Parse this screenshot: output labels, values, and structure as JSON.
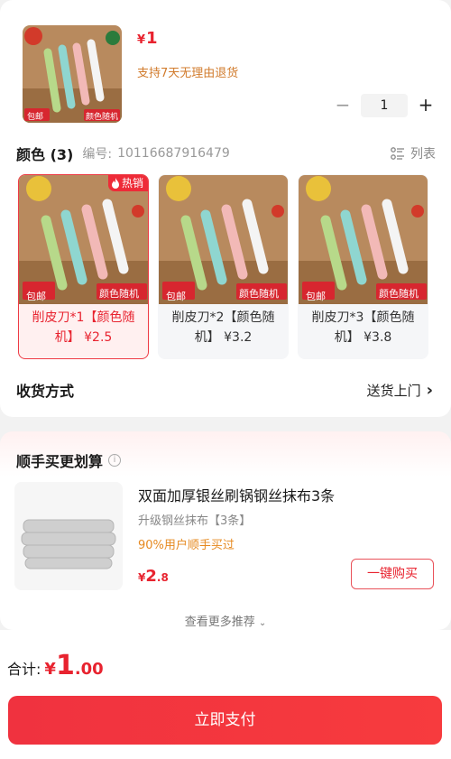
{
  "product": {
    "price_currency": "¥",
    "price": "1",
    "return_note": "支持7天无理由退货",
    "quantity": "1",
    "minus": "−",
    "plus": "+",
    "thumb_badge_left": "包邮",
    "thumb_badge_right": "颜色随机"
  },
  "color_section": {
    "title": "颜色 (3)",
    "sku_label": "编号:",
    "sku_number": "10116687916479",
    "list_toggle": "列表"
  },
  "variants": [
    {
      "label": "削皮刀*1【颜色随机】 ¥2.5",
      "selected": true,
      "badge": "热销",
      "tag_left": "包邮",
      "tag_right": "颜色随机"
    },
    {
      "label": "削皮刀*2【颜色随机】 ¥3.2",
      "selected": false,
      "tag_left": "包邮",
      "tag_right": "颜色随机"
    },
    {
      "label": "削皮刀*3【颜色随机】 ¥3.8",
      "selected": false,
      "tag_left": "包邮",
      "tag_right": "颜色随机"
    }
  ],
  "shipping": {
    "label": "收货方式",
    "value": "送货上门"
  },
  "bundle": {
    "title": "顺手买更划算",
    "item_name": "双面加厚银丝刷锅钢丝抹布3条",
    "item_sub": "升级钢丝抹布【3条】",
    "item_pct": "90%用户顺手买过",
    "price_currency": "¥",
    "price_int": "2",
    "price_dec": ".8",
    "buy_label": "一键购买",
    "more_label": "查看更多推荐"
  },
  "footer": {
    "total_label": "合计:",
    "currency": "¥",
    "total_int": "1",
    "total_dec": ".00",
    "pay_label": "立即支付"
  },
  "colors": {
    "accent": "#e8232f",
    "orange": "#d17b2c",
    "pay_button": "#f0323f"
  },
  "icons": [
    "flame-icon",
    "list-view-icon",
    "info-icon",
    "chevron-right-icon",
    "chevron-down-icon"
  ]
}
